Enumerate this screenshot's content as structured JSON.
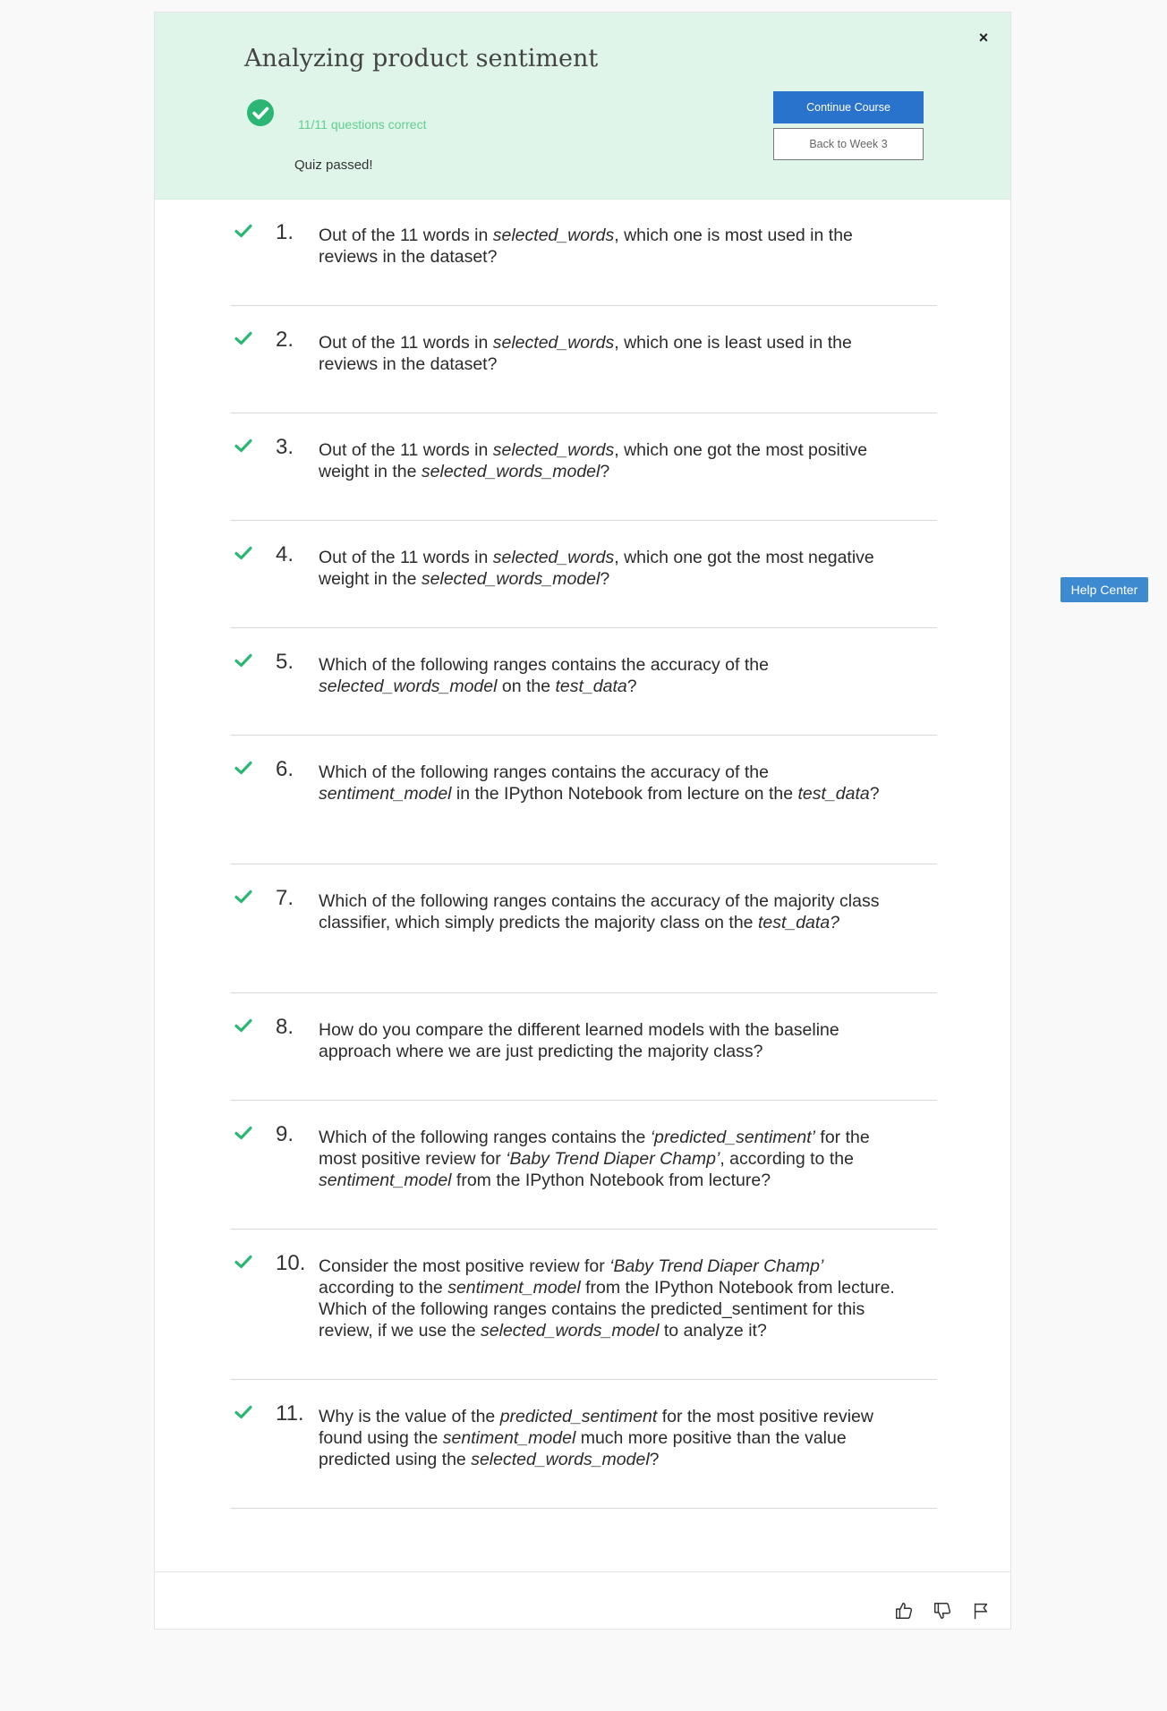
{
  "header": {
    "title": "Analyzing product sentiment",
    "score": "11/11 questions correct",
    "status": "Quiz passed!",
    "continue_label": "Continue Course",
    "back_label": "Back to Week 3",
    "close_symbol": "×"
  },
  "questions": [
    {
      "number": "1.",
      "html": "Out of the 11 words in <i>selected_words</i>, which one is most used in the reviews in the dataset?",
      "correct": true
    },
    {
      "number": "2.",
      "html": "Out of the 11 words in <i>selected_words</i>, which one is least used in the reviews in the dataset?",
      "correct": true
    },
    {
      "number": "3.",
      "html": "Out of the 11 words in <i>selected_words</i>, which one got the most positive weight in the <i>selected_words_model</i>?",
      "correct": true
    },
    {
      "number": "4.",
      "html": "Out of the 11 words in <i>selected_words</i>, which one got the most negative weight in the <i>selected_words_model</i>?",
      "correct": true
    },
    {
      "number": "5.",
      "html": "Which of the following ranges contains the accuracy of the <i>selected_words_model</i> on the <i>test_data</i>?",
      "correct": true
    },
    {
      "number": "6.",
      "html": "Which of the following ranges contains the accuracy of the <i>sentiment_model</i> in the IPython Notebook from lecture on the <i>test_data</i>?",
      "correct": true
    },
    {
      "number": "7.",
      "html": "Which of the following ranges contains the accuracy of the majority class classifier, which simply predicts the majority class on the <i>test_data?</i>",
      "correct": true
    },
    {
      "number": "8.",
      "html": "How do you compare the different learned models with the baseline approach where we are just predicting the majority class?",
      "correct": true
    },
    {
      "number": "9.",
      "html": "Which of the following ranges contains the <i>‘predicted_sentiment’</i> for the most positive review for <i>‘Baby Trend Diaper Champ’</i>, according to the <i>sentiment_model</i> from the IPython Notebook from lecture?",
      "correct": true
    },
    {
      "number": "10.",
      "html": "Consider the most positive review for <i>‘Baby Trend Diaper Champ’</i> according to the <i>sentiment_model</i> from the IPython Notebook from lecture. Which of the following ranges contains the predicted_sentiment for this review, if we use the <i>selected_words_model</i> to analyze it?",
      "correct": true
    },
    {
      "number": "11.",
      "html": "Why is the value of the <i>predicted_sentiment</i> for the most positive review found using the <i>sentiment_model</i> much more positive than the value predicted using the <i>selected_words_model</i>?",
      "correct": true
    }
  ],
  "footer": {
    "icons": [
      "thumbs-up-icon",
      "thumbs-down-icon",
      "flag-icon"
    ]
  },
  "help_center": "Help Center",
  "colors": {
    "header_bg": "#e0f5ea",
    "success": "#2bb673",
    "score_text": "#5fce8f",
    "primary_button": "#2a73cc",
    "help_button": "#3d8ad0"
  }
}
